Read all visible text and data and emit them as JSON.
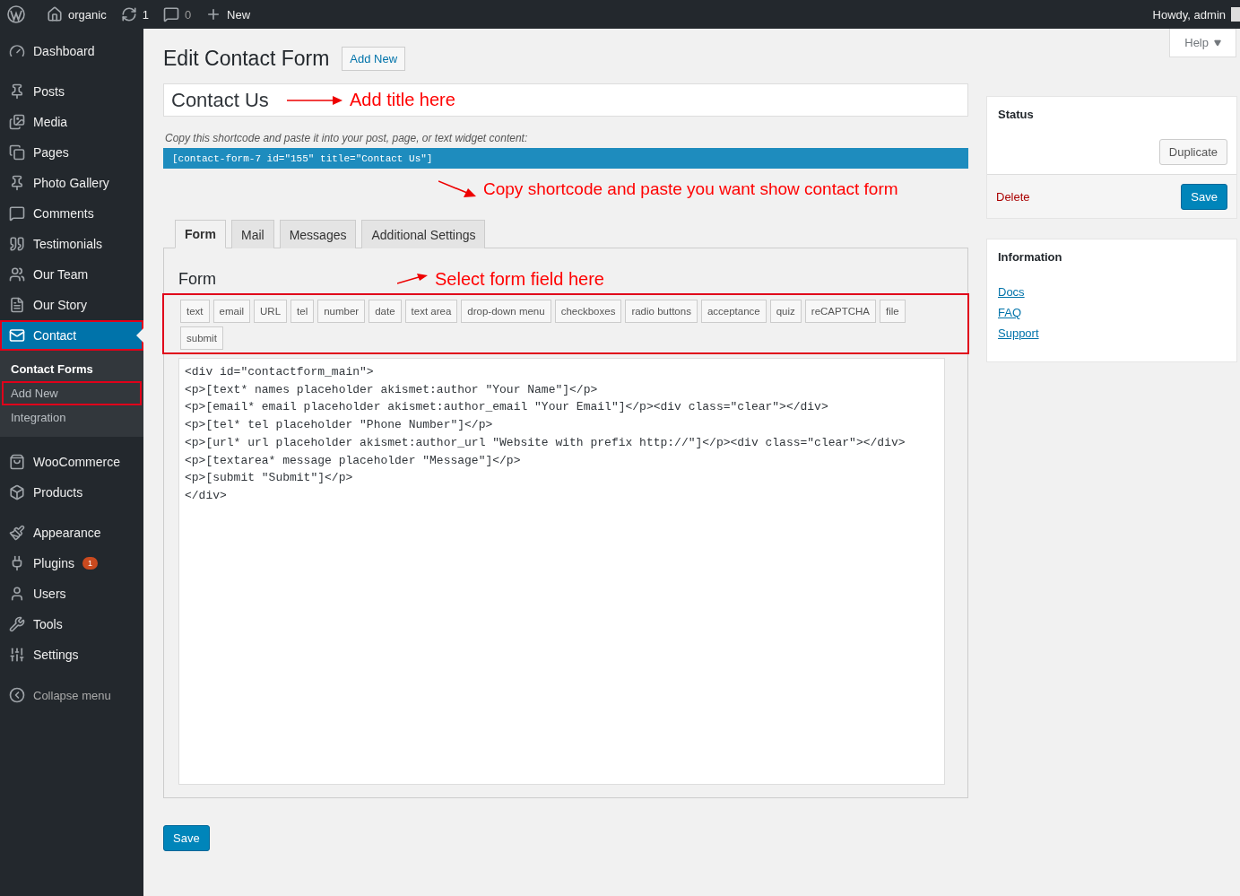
{
  "admin_bar": {
    "site": "organic",
    "updates": "1",
    "comments": "0",
    "new": "New",
    "greeting": "Howdy, admin"
  },
  "sidebar": {
    "groups": [
      [
        {
          "label": "Dashboard",
          "selected": false
        }
      ],
      [
        {
          "label": "Posts",
          "selected": false
        },
        {
          "label": "Media",
          "selected": false
        },
        {
          "label": "Pages",
          "selected": false
        },
        {
          "label": "Photo Gallery",
          "selected": false
        },
        {
          "label": "Comments",
          "selected": false
        },
        {
          "label": "Testimonials",
          "selected": false
        },
        {
          "label": "Our Team",
          "selected": false
        },
        {
          "label": "Our Story",
          "selected": false
        },
        {
          "label": "Contact",
          "selected": true,
          "highlighted": true,
          "children": [
            {
              "label": "Contact Forms",
              "selected": true,
              "highlighted": false
            },
            {
              "label": "Add New",
              "selected": false,
              "highlighted": true
            },
            {
              "label": "Integration",
              "selected": false,
              "highlighted": false
            }
          ]
        }
      ],
      [
        {
          "label": "WooCommerce",
          "selected": false
        },
        {
          "label": "Products",
          "selected": false
        }
      ],
      [
        {
          "label": "Appearance",
          "selected": false
        },
        {
          "label": "Plugins",
          "selected": false,
          "badge": "1"
        },
        {
          "label": "Users",
          "selected": false
        },
        {
          "label": "Tools",
          "selected": false
        },
        {
          "label": "Settings",
          "selected": false
        }
      ]
    ],
    "collapse": "Collapse menu"
  },
  "help": "Help",
  "page_title": "Edit Contact Form",
  "add_new": "Add New",
  "title_field": {
    "value": "Contact Us",
    "annotation": "Add title here"
  },
  "shortcode": {
    "hint": "Copy this shortcode and paste it into your post, page, or text widget content:",
    "code": "[contact-form-7 id=\"155\" title=\"Contact Us\"]",
    "annotation": "Copy shortcode and paste you want show contact form"
  },
  "tabs": [
    {
      "label": "Form",
      "selected": true
    },
    {
      "label": "Mail",
      "selected": false
    },
    {
      "label": "Messages",
      "selected": false
    },
    {
      "label": "Additional Settings",
      "selected": false
    }
  ],
  "form": {
    "heading": "Form",
    "annotation": "Select form field here",
    "tags_highlighted": true,
    "tags": [
      "text",
      "email",
      "URL",
      "tel",
      "number",
      "date",
      "text area",
      "drop-down menu",
      "checkboxes",
      "radio buttons",
      "acceptance",
      "quiz",
      "reCAPTCHA",
      "file",
      "submit"
    ],
    "code": [
      "<div id=\"contactform_main\">",
      "<p>[text* names placeholder akismet:author \"Your Name\"]</p>",
      "<p>[email* email placeholder akismet:author_email \"Your Email\"]</p><div class=\"clear\"></div>",
      "<p>[tel* tel placeholder \"Phone Number\"]</p>",
      "<p>[url* url placeholder akismet:author_url \"Website with prefix http://\"]</p><div class=\"clear\"></div>",
      "<p>[textarea* message placeholder \"Message\"]</p>",
      "<p>[submit \"Submit\"]</p>",
      "</div>"
    ]
  },
  "save": "Save",
  "status_box": {
    "title": "Status",
    "duplicate": "Duplicate",
    "delete": "Delete",
    "save": "Save"
  },
  "info_box": {
    "title": "Information",
    "links": [
      "Docs",
      "FAQ",
      "Support"
    ]
  }
}
